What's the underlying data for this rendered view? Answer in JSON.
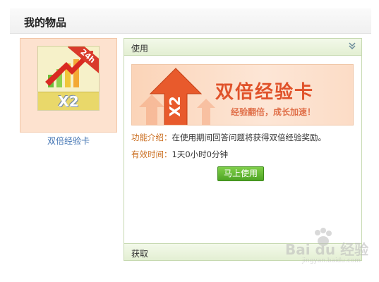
{
  "page": {
    "title": "我的物品"
  },
  "item": {
    "name": "双倍经验卡",
    "badge": "24h",
    "multiplier": "X2"
  },
  "panel": {
    "header_label": "使用",
    "collapse_icon": "double-chevron-down-icon",
    "banner": {
      "title": "双倍经验卡",
      "subtitle": "经验翻倍，成长加速！",
      "arrow_label": "X2"
    },
    "description_label": "功能介绍：",
    "description_value": "在使用期间回答问题将获得双倍经验奖励。",
    "duration_label": "有效时间：",
    "duration_value": "1天0小时0分钟",
    "use_button_label": "马上使用",
    "footer_label": "获取"
  },
  "watermark": {
    "text": "Bai du 经验",
    "sub": "jingyan.baidu.com"
  },
  "colors": {
    "accent_orange": "#e0522a",
    "button_green": "#4ea424",
    "panel_border": "#c6d9b0"
  }
}
